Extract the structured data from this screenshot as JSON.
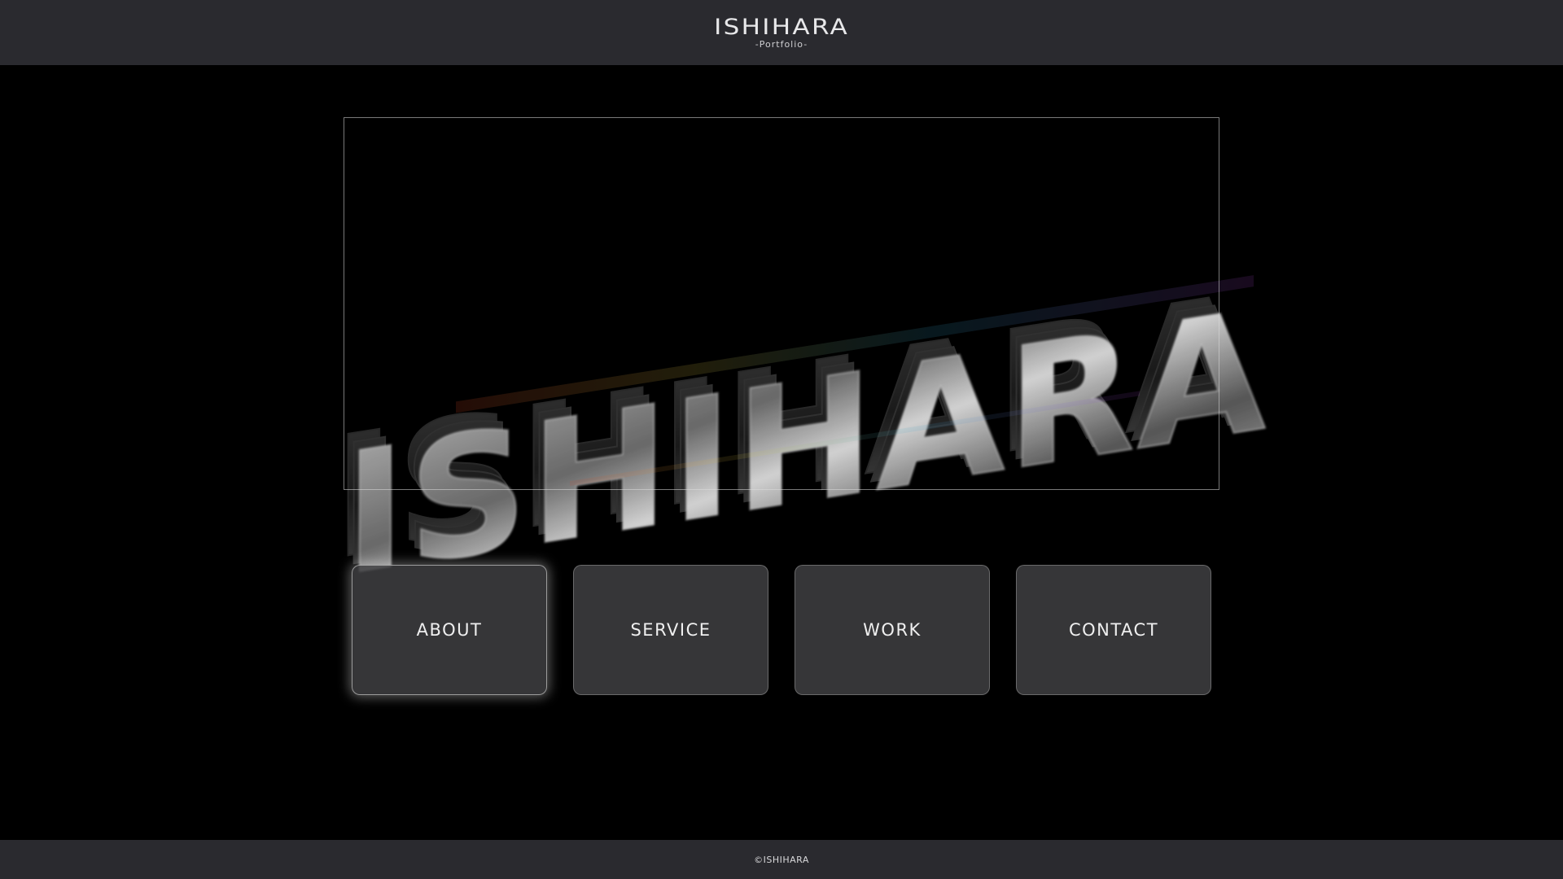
{
  "header": {
    "title": "ISHIHARA",
    "subtitle": "-Portfolio-"
  },
  "hero": {
    "graphic_text": "ISHIHARA"
  },
  "nav": {
    "items": [
      {
        "label": "ABOUT",
        "active": true
      },
      {
        "label": "SERVICE",
        "active": false
      },
      {
        "label": "WORK",
        "active": false
      },
      {
        "label": "CONTACT",
        "active": false
      }
    ]
  },
  "footer": {
    "copyright": "©ISHIHARA"
  },
  "colors": {
    "header_bg": "#2a2a2f",
    "stage_bg": "#000000",
    "button_bg": "#424244",
    "text": "#efefef"
  }
}
